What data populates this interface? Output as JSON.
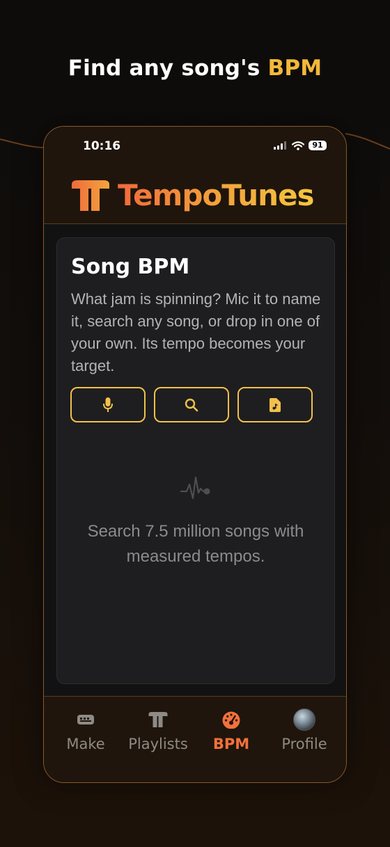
{
  "headline": {
    "text": "Find any song's ",
    "accent": "BPM"
  },
  "status_bar": {
    "time": "10:16",
    "battery": "91"
  },
  "brand": {
    "name": "TempoTunes"
  },
  "card": {
    "title": "Song BPM",
    "description": "What jam is spinning? Mic it to name it, search any song, or drop in one of your own. Its tempo becomes your target.",
    "buttons": [
      {
        "icon": "microphone-icon"
      },
      {
        "icon": "search-icon"
      },
      {
        "icon": "music-file-icon"
      }
    ],
    "empty_state": {
      "icon": "waveform-icon",
      "text": "Search 7.5 million songs with measured tempos."
    }
  },
  "tabs": [
    {
      "label": "Make",
      "icon": "gamepad-icon",
      "active": false
    },
    {
      "label": "Playlists",
      "icon": "tempotunes-logo-icon",
      "active": false
    },
    {
      "label": "BPM",
      "icon": "speedometer-icon",
      "active": true
    },
    {
      "label": "Profile",
      "icon": "avatar",
      "active": false
    }
  ],
  "colors": {
    "accent_yellow": "#f3b83a",
    "accent_orange": "#f2713c",
    "button_border": "#f3c04a",
    "card_bg": "#1e1e20"
  }
}
